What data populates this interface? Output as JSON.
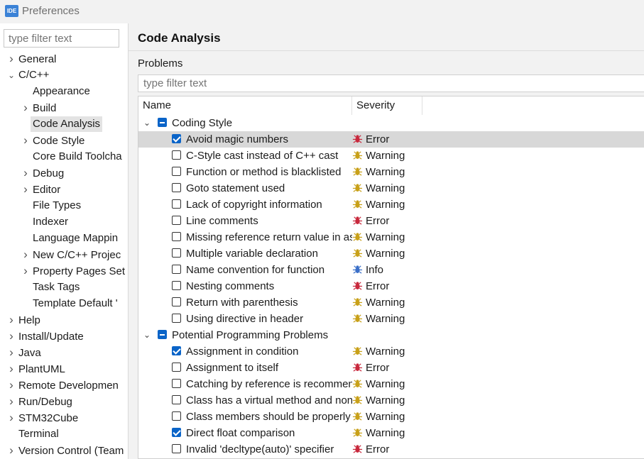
{
  "window": {
    "app_icon_text": "IDE",
    "title": "Preferences"
  },
  "left_panel": {
    "filter_placeholder": "type filter text",
    "tree": [
      {
        "label": "General",
        "level": 0,
        "expander": "collapsed"
      },
      {
        "label": "C/C++",
        "level": 0,
        "expander": "expanded"
      },
      {
        "label": "Appearance",
        "level": 1,
        "expander": "none"
      },
      {
        "label": "Build",
        "level": 1,
        "expander": "collapsed"
      },
      {
        "label": "Code Analysis",
        "level": 1,
        "expander": "none",
        "selected": true
      },
      {
        "label": "Code Style",
        "level": 1,
        "expander": "collapsed"
      },
      {
        "label": "Core Build Toolcha",
        "level": 1,
        "expander": "none"
      },
      {
        "label": "Debug",
        "level": 1,
        "expander": "collapsed"
      },
      {
        "label": "Editor",
        "level": 1,
        "expander": "collapsed"
      },
      {
        "label": "File Types",
        "level": 1,
        "expander": "none"
      },
      {
        "label": "Indexer",
        "level": 1,
        "expander": "none"
      },
      {
        "label": "Language Mappin",
        "level": 1,
        "expander": "none"
      },
      {
        "label": "New C/C++ Projec",
        "level": 1,
        "expander": "collapsed"
      },
      {
        "label": "Property Pages Set",
        "level": 1,
        "expander": "collapsed"
      },
      {
        "label": "Task Tags",
        "level": 1,
        "expander": "none"
      },
      {
        "label": "Template Default '",
        "level": 1,
        "expander": "none"
      },
      {
        "label": "Help",
        "level": 0,
        "expander": "collapsed"
      },
      {
        "label": "Install/Update",
        "level": 0,
        "expander": "collapsed"
      },
      {
        "label": "Java",
        "level": 0,
        "expander": "collapsed"
      },
      {
        "label": "PlantUML",
        "level": 0,
        "expander": "collapsed"
      },
      {
        "label": "Remote Developmen",
        "level": 0,
        "expander": "collapsed"
      },
      {
        "label": "Run/Debug",
        "level": 0,
        "expander": "collapsed"
      },
      {
        "label": "STM32Cube",
        "level": 0,
        "expander": "collapsed"
      },
      {
        "label": "Terminal",
        "level": 0,
        "expander": "none"
      },
      {
        "label": "Version Control (Team",
        "level": 0,
        "expander": "collapsed"
      }
    ]
  },
  "main": {
    "title": "Code Analysis",
    "problems_label": "Problems",
    "filter_placeholder": "type filter text",
    "columns": {
      "name": "Name",
      "severity": "Severity"
    },
    "rows": [
      {
        "type": "group",
        "label": "Coding Style",
        "check": "partial"
      },
      {
        "type": "item",
        "label": "Avoid magic numbers",
        "checked": true,
        "severity": "Error",
        "highlight": true
      },
      {
        "type": "item",
        "label": "C-Style cast instead of C++ cast",
        "checked": false,
        "severity": "Warning"
      },
      {
        "type": "item",
        "label": "Function or method is blacklisted",
        "checked": false,
        "severity": "Warning"
      },
      {
        "type": "item",
        "label": "Goto statement used",
        "checked": false,
        "severity": "Warning"
      },
      {
        "type": "item",
        "label": "Lack of copyright information",
        "checked": false,
        "severity": "Warning"
      },
      {
        "type": "item",
        "label": "Line comments",
        "checked": false,
        "severity": "Error"
      },
      {
        "type": "item",
        "label": "Missing reference return value in as",
        "checked": false,
        "severity": "Warning"
      },
      {
        "type": "item",
        "label": "Multiple variable declaration",
        "checked": false,
        "severity": "Warning"
      },
      {
        "type": "item",
        "label": "Name convention for function",
        "checked": false,
        "severity": "Info"
      },
      {
        "type": "item",
        "label": "Nesting comments",
        "checked": false,
        "severity": "Error"
      },
      {
        "type": "item",
        "label": "Return with parenthesis",
        "checked": false,
        "severity": "Warning"
      },
      {
        "type": "item",
        "label": "Using directive in header",
        "checked": false,
        "severity": "Warning"
      },
      {
        "type": "group",
        "label": "Potential Programming Problems",
        "check": "partial"
      },
      {
        "type": "item",
        "label": "Assignment in condition",
        "checked": true,
        "severity": "Warning"
      },
      {
        "type": "item",
        "label": "Assignment to itself",
        "checked": false,
        "severity": "Error"
      },
      {
        "type": "item",
        "label": "Catching by reference is recommen",
        "checked": false,
        "severity": "Warning"
      },
      {
        "type": "item",
        "label": "Class has a virtual method and non-",
        "checked": false,
        "severity": "Warning"
      },
      {
        "type": "item",
        "label": "Class members should be properly",
        "checked": false,
        "severity": "Warning"
      },
      {
        "type": "item",
        "label": "Direct float comparison",
        "checked": true,
        "severity": "Warning"
      },
      {
        "type": "item",
        "label": "Invalid 'decltype(auto)' specifier",
        "checked": false,
        "severity": "Error"
      }
    ]
  },
  "severity_colors": {
    "Error": "#c8283c",
    "Warning": "#c8a018",
    "Info": "#3a6fc8"
  },
  "icons": {
    "expanded": "chevron-down-icon",
    "collapsed": "chevron-right-icon",
    "severity": "bug-icon"
  }
}
